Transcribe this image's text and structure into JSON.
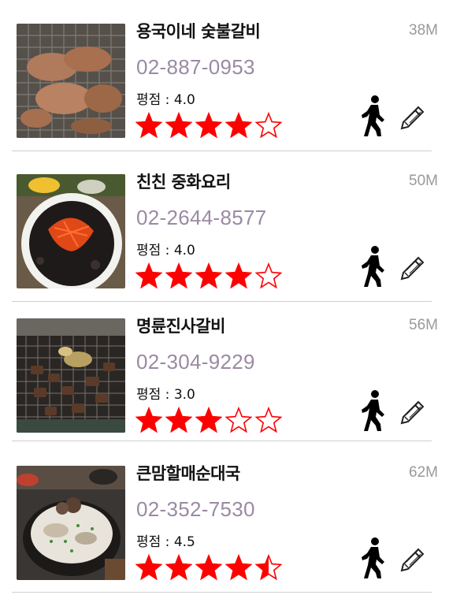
{
  "restaurants": [
    {
      "name": "용국이네 숯불갈비",
      "distance": "38M",
      "phone": "02-887-0953",
      "rating_text": "평점 : 4.0",
      "rating": 4.0
    },
    {
      "name": "친친 중화요리",
      "distance": "50M",
      "phone": "02-2644-8577",
      "rating_text": "평점 : 4.0",
      "rating": 4.0
    },
    {
      "name": "명륜진사갈비",
      "distance": "56M",
      "phone": "02-304-9229",
      "rating_text": "평점 : 3.0",
      "rating": 3.0
    },
    {
      "name": "큰맘할매순대국",
      "distance": "62M",
      "phone": "02-352-7530",
      "rating_text": "평점 : 4.5",
      "rating": 4.5
    }
  ],
  "icons": {
    "walk": "walking-person-icon",
    "edit": "pencil-icon",
    "star_filled": "star-filled-icon",
    "star_empty": "star-outline-icon"
  },
  "colors": {
    "star": "#ff0000",
    "phone": "#9a8aa4",
    "distance": "#9a9a9a"
  }
}
